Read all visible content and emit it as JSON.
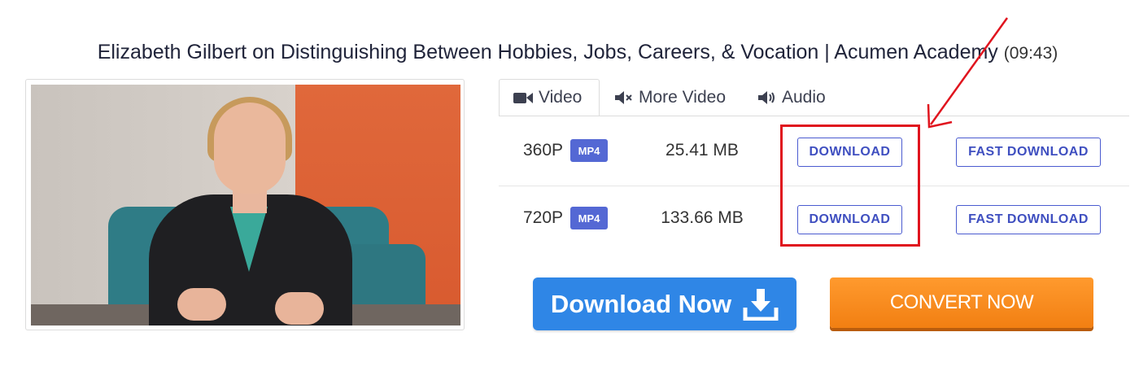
{
  "video": {
    "title": "Elizabeth Gilbert on Distinguishing Between Hobbies, Jobs, Careers, & Vocation | Acumen Academy",
    "duration": "(09:43)"
  },
  "tabs": [
    {
      "label": "Video",
      "icon": "video-camera-icon",
      "active": true
    },
    {
      "label": "More Video",
      "icon": "muted-speaker-icon",
      "active": false
    },
    {
      "label": "Audio",
      "icon": "speaker-icon",
      "active": false
    }
  ],
  "rows": [
    {
      "quality": "360P",
      "format": "MP4",
      "size": "25.41 MB",
      "download_label": "DOWNLOAD",
      "fast_label": "FAST DOWNLOAD"
    },
    {
      "quality": "720P",
      "format": "MP4",
      "size": "133.66 MB",
      "download_label": "DOWNLOAD",
      "fast_label": "FAST DOWNLOAD"
    }
  ],
  "actions": {
    "download_now": "Download Now",
    "convert_now": "CONVERT NOW"
  },
  "colors": {
    "accent_blue": "#4a5bd0",
    "badge": "#5468d4",
    "download_now_bg": "#2f86e6",
    "convert_bg": "#f5881b",
    "annotation": "#e0141e"
  }
}
